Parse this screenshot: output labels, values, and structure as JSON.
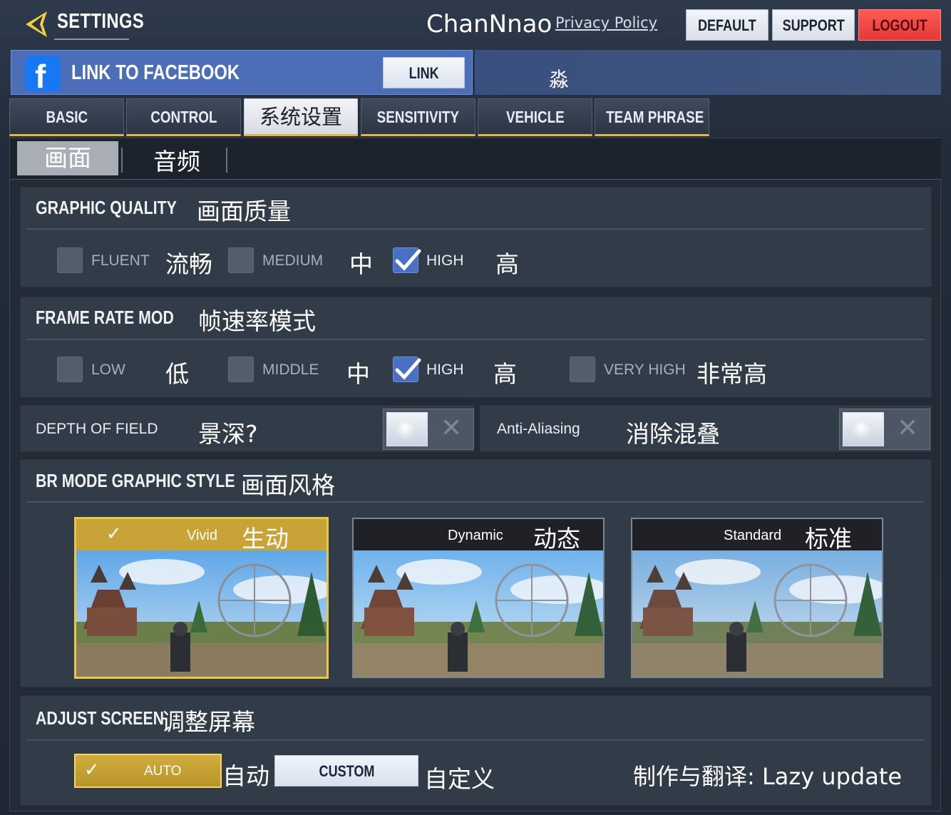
{
  "header": {
    "title": "SETTINGS",
    "author": "ChanNnao",
    "privacy_link": "Privacy Policy",
    "buttons": {
      "default": "DEFAULT",
      "support": "SUPPORT",
      "logout": "LOGOUT"
    }
  },
  "facebook": {
    "label": "LINK TO FACEBOOK",
    "link_button": "LINK",
    "translation": "淼"
  },
  "main_tabs": [
    {
      "label": "BASIC",
      "active": false
    },
    {
      "label": "CONTROL",
      "active": false
    },
    {
      "label": "系统设置",
      "active": true
    },
    {
      "label": "SENSITIVITY",
      "active": false
    },
    {
      "label": "VEHICLE",
      "active": false
    },
    {
      "label": "TEAM PHRASE",
      "active": false
    }
  ],
  "sub_tabs": [
    {
      "label": "画面",
      "active": true
    },
    {
      "label": "音频",
      "active": false
    }
  ],
  "graphic_quality": {
    "title": "GRAPHIC QUALITY",
    "title_cn": "画面质量",
    "options": [
      {
        "label": "FLUENT",
        "cn": "流畅",
        "checked": false
      },
      {
        "label": "MEDIUM",
        "cn": "中",
        "checked": false
      },
      {
        "label": "HIGH",
        "cn": "高",
        "checked": true
      }
    ]
  },
  "frame_rate": {
    "title": "FRAME RATE MOD",
    "title_cn": "帧速率模式",
    "options": [
      {
        "label": "LOW",
        "cn": "低",
        "checked": false
      },
      {
        "label": "MIDDLE",
        "cn": "中",
        "checked": false
      },
      {
        "label": "HIGH",
        "cn": "高",
        "checked": true
      },
      {
        "label": "VERY HIGH",
        "cn": "非常高",
        "checked": false
      }
    ]
  },
  "depth_of_field": {
    "title": "DEPTH OF FIELD",
    "title_cn": "景深?",
    "enabled": false
  },
  "anti_aliasing": {
    "title": "Anti-Aliasing",
    "title_cn": "消除混叠",
    "enabled": false
  },
  "graphic_style": {
    "title": "BR MODE GRAPHIC STYLE",
    "title_cn": "画面风格",
    "check_glyph": "✓",
    "cards": [
      {
        "label": "Vivid",
        "cn": "生动",
        "selected": true
      },
      {
        "label": "Dynamic",
        "cn": "动态",
        "selected": false
      },
      {
        "label": "Standard",
        "cn": "标准",
        "selected": false
      }
    ]
  },
  "adjust_screen": {
    "title": "ADJUST SCREEN",
    "title_cn": "调整屏幕",
    "check_glyph": "✓",
    "auto_label": "AUTO",
    "auto_cn": "自动",
    "custom_label": "CUSTOM",
    "custom_cn": "自定义",
    "selected": "AUTO"
  },
  "credit": "制作与翻译: Lazy update",
  "colors": {
    "accent_gold": "#e7c74a",
    "checkbox_blue": "#4970c4",
    "logout_red": "#f04a45",
    "facebook_blue": "#4c6db8"
  }
}
